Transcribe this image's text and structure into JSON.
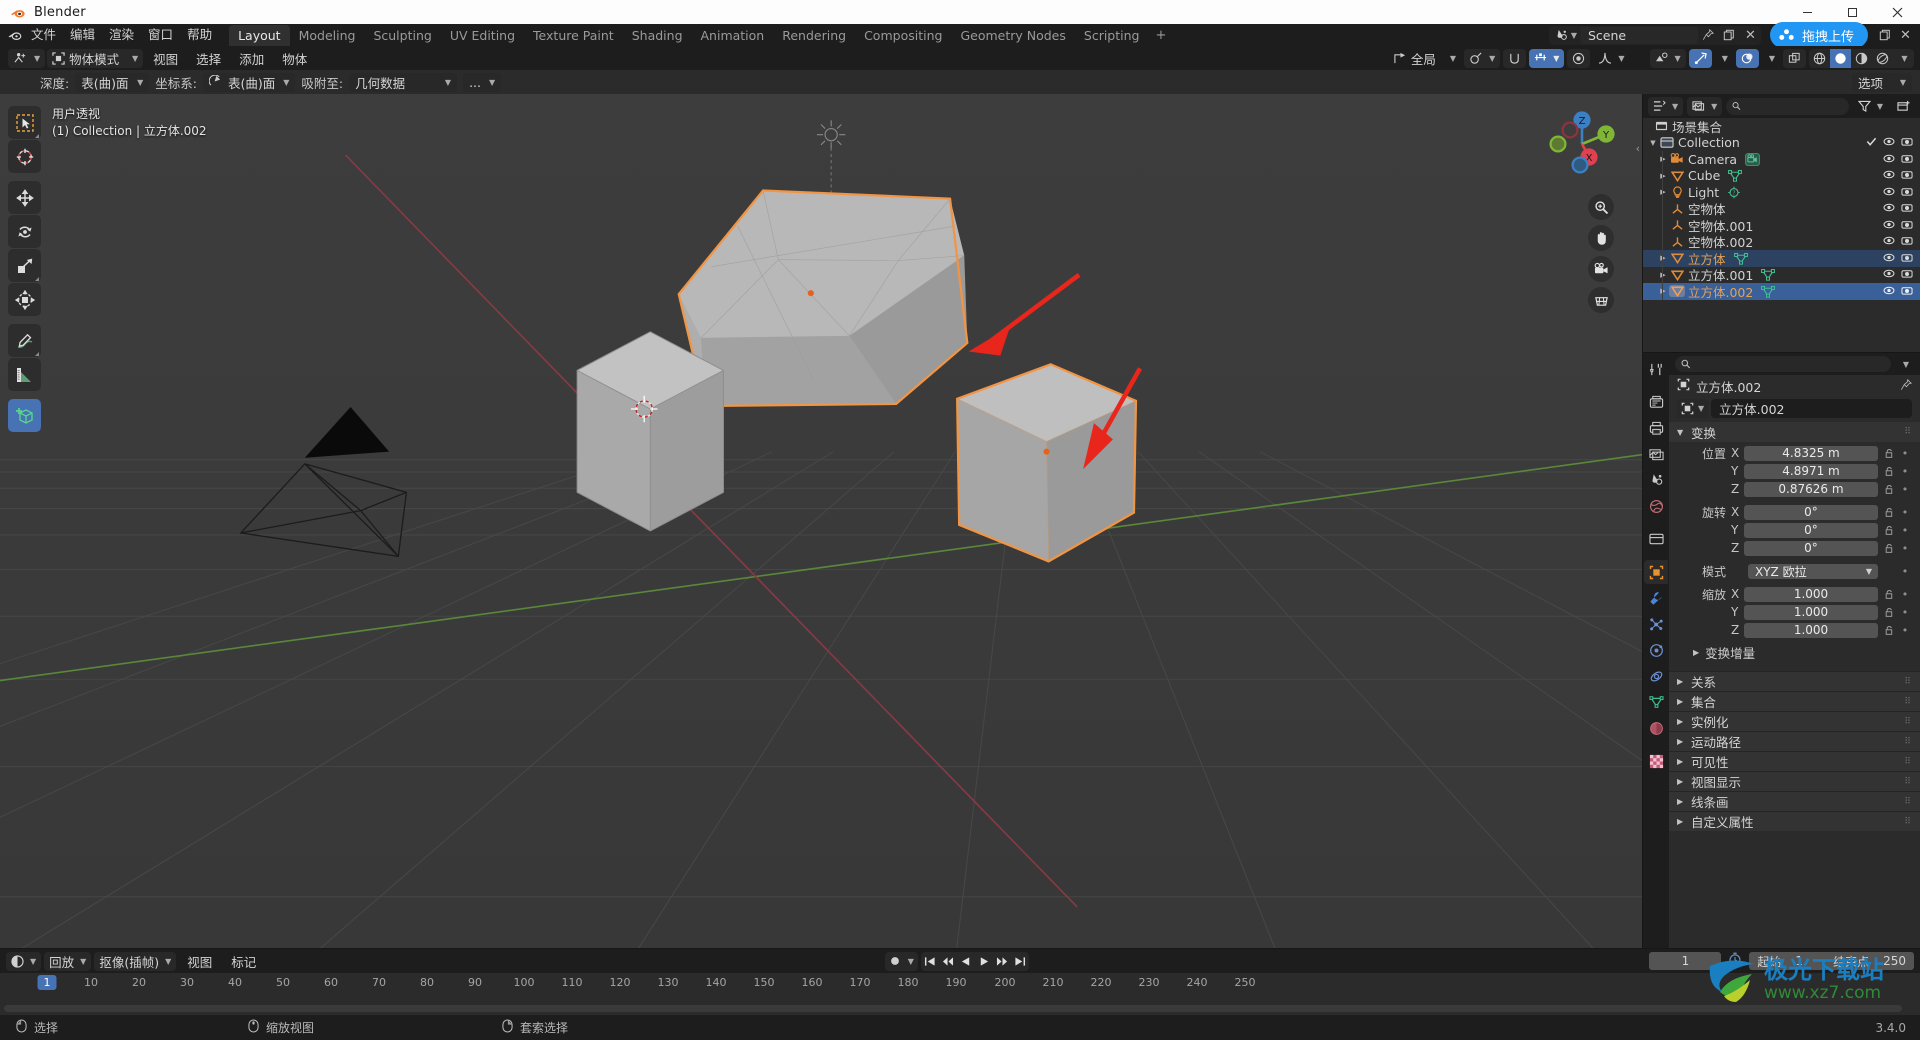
{
  "window": {
    "title": "Blender",
    "minimize": "–",
    "maximize": "☐",
    "close": "✕"
  },
  "topbar": {
    "menus": [
      "文件",
      "编辑",
      "渲染",
      "窗口",
      "帮助"
    ],
    "workspaces": [
      "Layout",
      "Modeling",
      "Sculpting",
      "UV Editing",
      "Texture Paint",
      "Shading",
      "Animation",
      "Rendering",
      "Compositing",
      "Geometry Nodes",
      "Scripting"
    ],
    "active_workspace": "Layout",
    "add_workspace": "+",
    "scene_name": "Scene",
    "upload_label": "拖拽上传"
  },
  "toolbar": {
    "mode": "物体模式",
    "menus": [
      "视图",
      "选择",
      "添加",
      "物体"
    ],
    "transform_orientation": "全局",
    "options_label": "选项"
  },
  "snapbar": {
    "depth_label": "深度:",
    "depth_value": "表(曲)面",
    "orient_label": "坐标系:",
    "orient_value": "表(曲)面",
    "snapto_label": "吸附至:",
    "snapto_value": "几何数据",
    "more": "..."
  },
  "viewport": {
    "view_name": "用户透视",
    "collection_info": "(1) Collection | 立方体.002",
    "gizmo_axes": [
      "X",
      "Y",
      "Z"
    ],
    "tools": [
      {
        "name": "tweak-tool",
        "label": "选择"
      },
      {
        "name": "cursor-tool",
        "label": "游标"
      },
      {
        "name": "move-tool",
        "label": "移动"
      },
      {
        "name": "rotate-tool",
        "label": "旋转"
      },
      {
        "name": "scale-tool",
        "label": "缩放"
      },
      {
        "name": "transform-tool",
        "label": "变换"
      },
      {
        "name": "annotate-tool",
        "label": "标注"
      },
      {
        "name": "measure-tool",
        "label": "测量"
      },
      {
        "name": "add-cube-tool",
        "label": "添加立方体"
      }
    ],
    "active_tool": "add-cube-tool",
    "nav_buttons": [
      "zoom",
      "pan",
      "camera",
      "ortho"
    ]
  },
  "outliner": {
    "title": "场景集合",
    "search_placeholder": "",
    "rows": [
      {
        "indent": 0,
        "expand": "▼",
        "icon": "collection-icon",
        "label": "Collection",
        "orange": false,
        "selected": false,
        "active": false,
        "checkbox": true,
        "sub": null
      },
      {
        "indent": 1,
        "expand": "▶",
        "icon": "camera-icon",
        "label": "Camera",
        "orange": false,
        "selected": false,
        "active": false,
        "checkbox": false,
        "sub": "camera-data-icon"
      },
      {
        "indent": 1,
        "expand": "▶",
        "icon": "mesh-icon",
        "label": "Cube",
        "orange": false,
        "selected": false,
        "active": false,
        "checkbox": false,
        "sub": "mesh-data-icon"
      },
      {
        "indent": 1,
        "expand": "▶",
        "icon": "light-icon",
        "label": "Light",
        "orange": false,
        "selected": false,
        "active": false,
        "checkbox": false,
        "sub": "light-data-icon"
      },
      {
        "indent": 1,
        "expand": "",
        "icon": "empty-icon",
        "label": "空物体",
        "orange": false,
        "selected": false,
        "active": false,
        "checkbox": false,
        "sub": null
      },
      {
        "indent": 1,
        "expand": "",
        "icon": "empty-icon",
        "label": "空物体.001",
        "orange": false,
        "selected": false,
        "active": false,
        "checkbox": false,
        "sub": null
      },
      {
        "indent": 1,
        "expand": "",
        "icon": "empty-icon",
        "label": "空物体.002",
        "orange": false,
        "selected": false,
        "active": false,
        "checkbox": false,
        "sub": null
      },
      {
        "indent": 1,
        "expand": "▶",
        "icon": "mesh-icon",
        "label": "立方体",
        "orange": true,
        "selected": true,
        "active": false,
        "checkbox": false,
        "sub": "mesh-data-icon"
      },
      {
        "indent": 1,
        "expand": "▶",
        "icon": "mesh-icon",
        "label": "立方体.001",
        "orange": false,
        "selected": false,
        "active": false,
        "checkbox": false,
        "sub": "mesh-data-icon"
      },
      {
        "indent": 1,
        "expand": "▶",
        "icon": "mesh-icon",
        "label": "立方体.002",
        "orange": true,
        "selected": false,
        "active": true,
        "checkbox": false,
        "sub": "mesh-data-icon"
      }
    ]
  },
  "properties": {
    "search_placeholder": "",
    "breadcrumb_object": "立方体.002",
    "id_name": "立方体.002",
    "transform_panel": "变换",
    "location_label": "位置",
    "rotation_label": "旋转",
    "scale_label": "缩放",
    "mode_label": "模式",
    "rotation_mode": "XYZ 欧拉",
    "axes": [
      "X",
      "Y",
      "Z"
    ],
    "location": [
      "4.8325 m",
      "4.8971 m",
      "0.87626 m"
    ],
    "rotation": [
      "0°",
      "0°",
      "0°"
    ],
    "scale": [
      "1.000",
      "1.000",
      "1.000"
    ],
    "delta_transform": "变换增量",
    "panels": [
      "关系",
      "集合",
      "实例化",
      "运动路径",
      "可见性",
      "视图显示",
      "线条画",
      "自定义属性"
    ]
  },
  "timeline": {
    "playback_label": "回放",
    "keying_label": "抠像(插帧)",
    "view_label": "视图",
    "marker_label": "标记",
    "current_frame": "1",
    "start_label": "起始",
    "start_value": "1",
    "end_label": "结束点",
    "end_value": "250",
    "ticks": [
      10,
      20,
      30,
      40,
      50,
      60,
      70,
      80,
      90,
      100,
      110,
      120,
      130,
      140,
      150,
      160,
      170,
      180,
      190,
      200,
      210,
      220,
      230,
      240,
      250
    ],
    "playhead": "1"
  },
  "statusbar": {
    "items": [
      "选择",
      "缩放视图",
      "套索选择"
    ],
    "version": "3.4.0"
  },
  "watermark": {
    "text": "极光下载站",
    "url": "www.xz7.com"
  },
  "colors": {
    "accent_blue": "#4772b3",
    "upload_blue": "#2196f3",
    "orange_outline": "#f19545",
    "axis_x": "#e04050",
    "axis_y": "#7fb636",
    "axis_z": "#3b80c4"
  }
}
